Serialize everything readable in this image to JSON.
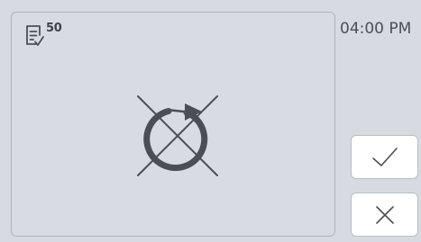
{
  "status": {
    "task_count": "50",
    "time": "04:00 PM"
  },
  "icons": {
    "task_list": "task-list-check-icon",
    "main": "repeat-disabled-icon",
    "confirm": "check-icon",
    "cancel": "close-icon"
  },
  "colors": {
    "background": "#d7dbe1",
    "panel": "#d8dce2",
    "icon": "#4a4f57",
    "button": "#ffffff"
  }
}
